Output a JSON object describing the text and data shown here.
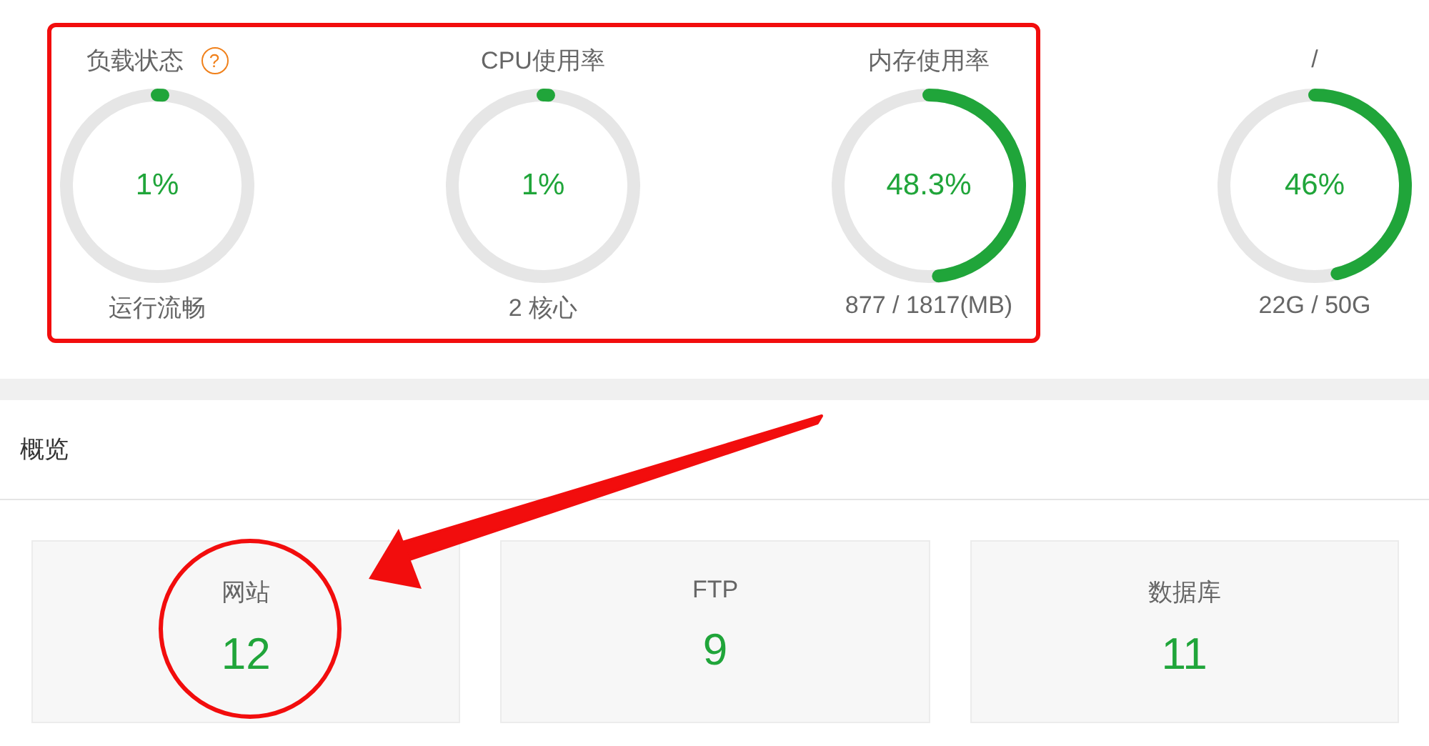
{
  "gauges": [
    {
      "title": "负载状态",
      "help": "?",
      "level": 0.01,
      "value": "1%",
      "detail": "运行流畅"
    },
    {
      "title": "CPU使用率",
      "level": 0.01,
      "value": "1%",
      "detail": "2 核心"
    },
    {
      "title": "内存使用率",
      "level": 0.483,
      "value": "48.3%",
      "detail": "877 / 1817(MB)"
    },
    {
      "title": "/",
      "level": 0.46,
      "value": "46%",
      "detail": "22G / 50G"
    }
  ],
  "overview": {
    "title": "概览",
    "cards": [
      {
        "label": "网站",
        "count": "12"
      },
      {
        "label": "FTP",
        "count": "9"
      },
      {
        "label": "数据库",
        "count": "11"
      }
    ]
  },
  "annotations": [
    {
      "kind": "rectangle"
    },
    {
      "kind": "circle"
    },
    {
      "kind": "arrow"
    }
  ]
}
